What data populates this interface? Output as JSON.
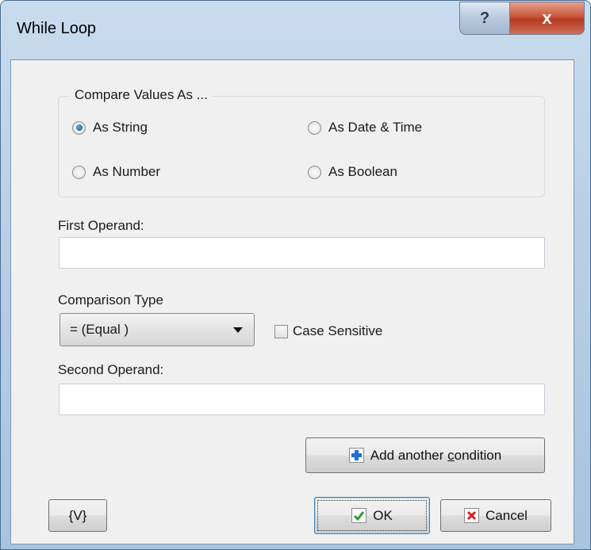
{
  "window": {
    "title": "While Loop"
  },
  "titlebar": {
    "help_label": "?",
    "close_label": "x"
  },
  "compare_group": {
    "legend": "Compare Values  As ...",
    "options": [
      {
        "label": "As String",
        "selected": true
      },
      {
        "label": "As Date & Time",
        "selected": false
      },
      {
        "label": "As Number",
        "selected": false
      },
      {
        "label": "As Boolean",
        "selected": false
      }
    ]
  },
  "first_operand": {
    "label": "First Operand:",
    "value": ""
  },
  "comparison": {
    "label": "Comparison Type",
    "selected": "= (Equal )",
    "case_sensitive_label": "Case Sensitive",
    "case_sensitive": false
  },
  "second_operand": {
    "label": "Second Operand:",
    "value": ""
  },
  "add_condition": {
    "label_prefix": "Add another ",
    "label_underlined": "c",
    "label_suffix": "ondition"
  },
  "footer": {
    "variables_label": "{V}",
    "ok_label": "OK",
    "cancel_label": "Cancel"
  },
  "colors": {
    "accent_blue": "#1e6fd0",
    "ok_green": "#2e9a2e",
    "cancel_red": "#d42020"
  }
}
